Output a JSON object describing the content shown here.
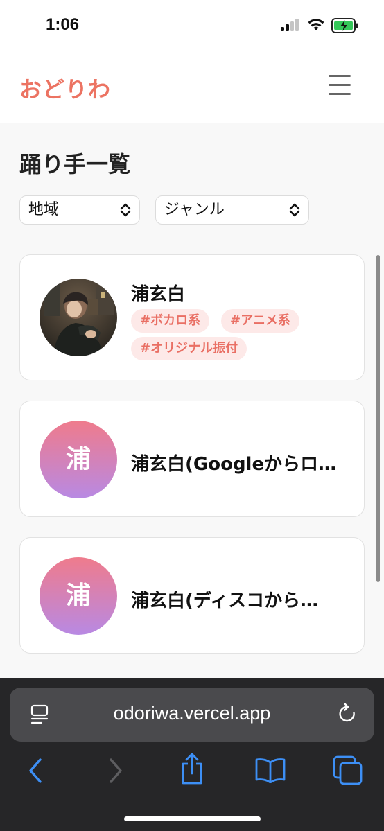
{
  "status_bar": {
    "time": "1:06"
  },
  "header": {
    "logo": "おどりわ"
  },
  "main": {
    "title": "踊り手一覧",
    "filters": {
      "region": {
        "selected": "地域"
      },
      "genre": {
        "selected": "ジャンル"
      }
    },
    "cards": [
      {
        "name": "浦玄白",
        "tags": [
          "#ボカロ系",
          "#アニメ系",
          "#オリジナル振付"
        ]
      },
      {
        "name": "浦玄白(Googleからロ…",
        "initial": "浦"
      },
      {
        "name": "浦玄白(ディスコから…",
        "initial": "浦"
      }
    ]
  },
  "browser": {
    "url": "odoriwa.vercel.app"
  },
  "colors": {
    "brand": "#ec7362",
    "tag_bg": "#fde9e8",
    "tag_text": "#e96f64",
    "avatar_gradient_start": "#ef7b8c",
    "avatar_gradient_end": "#b889e3",
    "browser_accent": "#3d8ff5"
  },
  "icons": [
    "menu-icon",
    "chevron-updown-icon",
    "reader-icon",
    "reload-icon",
    "back-icon",
    "forward-icon",
    "share-icon",
    "bookmarks-icon",
    "tabs-icon"
  ]
}
